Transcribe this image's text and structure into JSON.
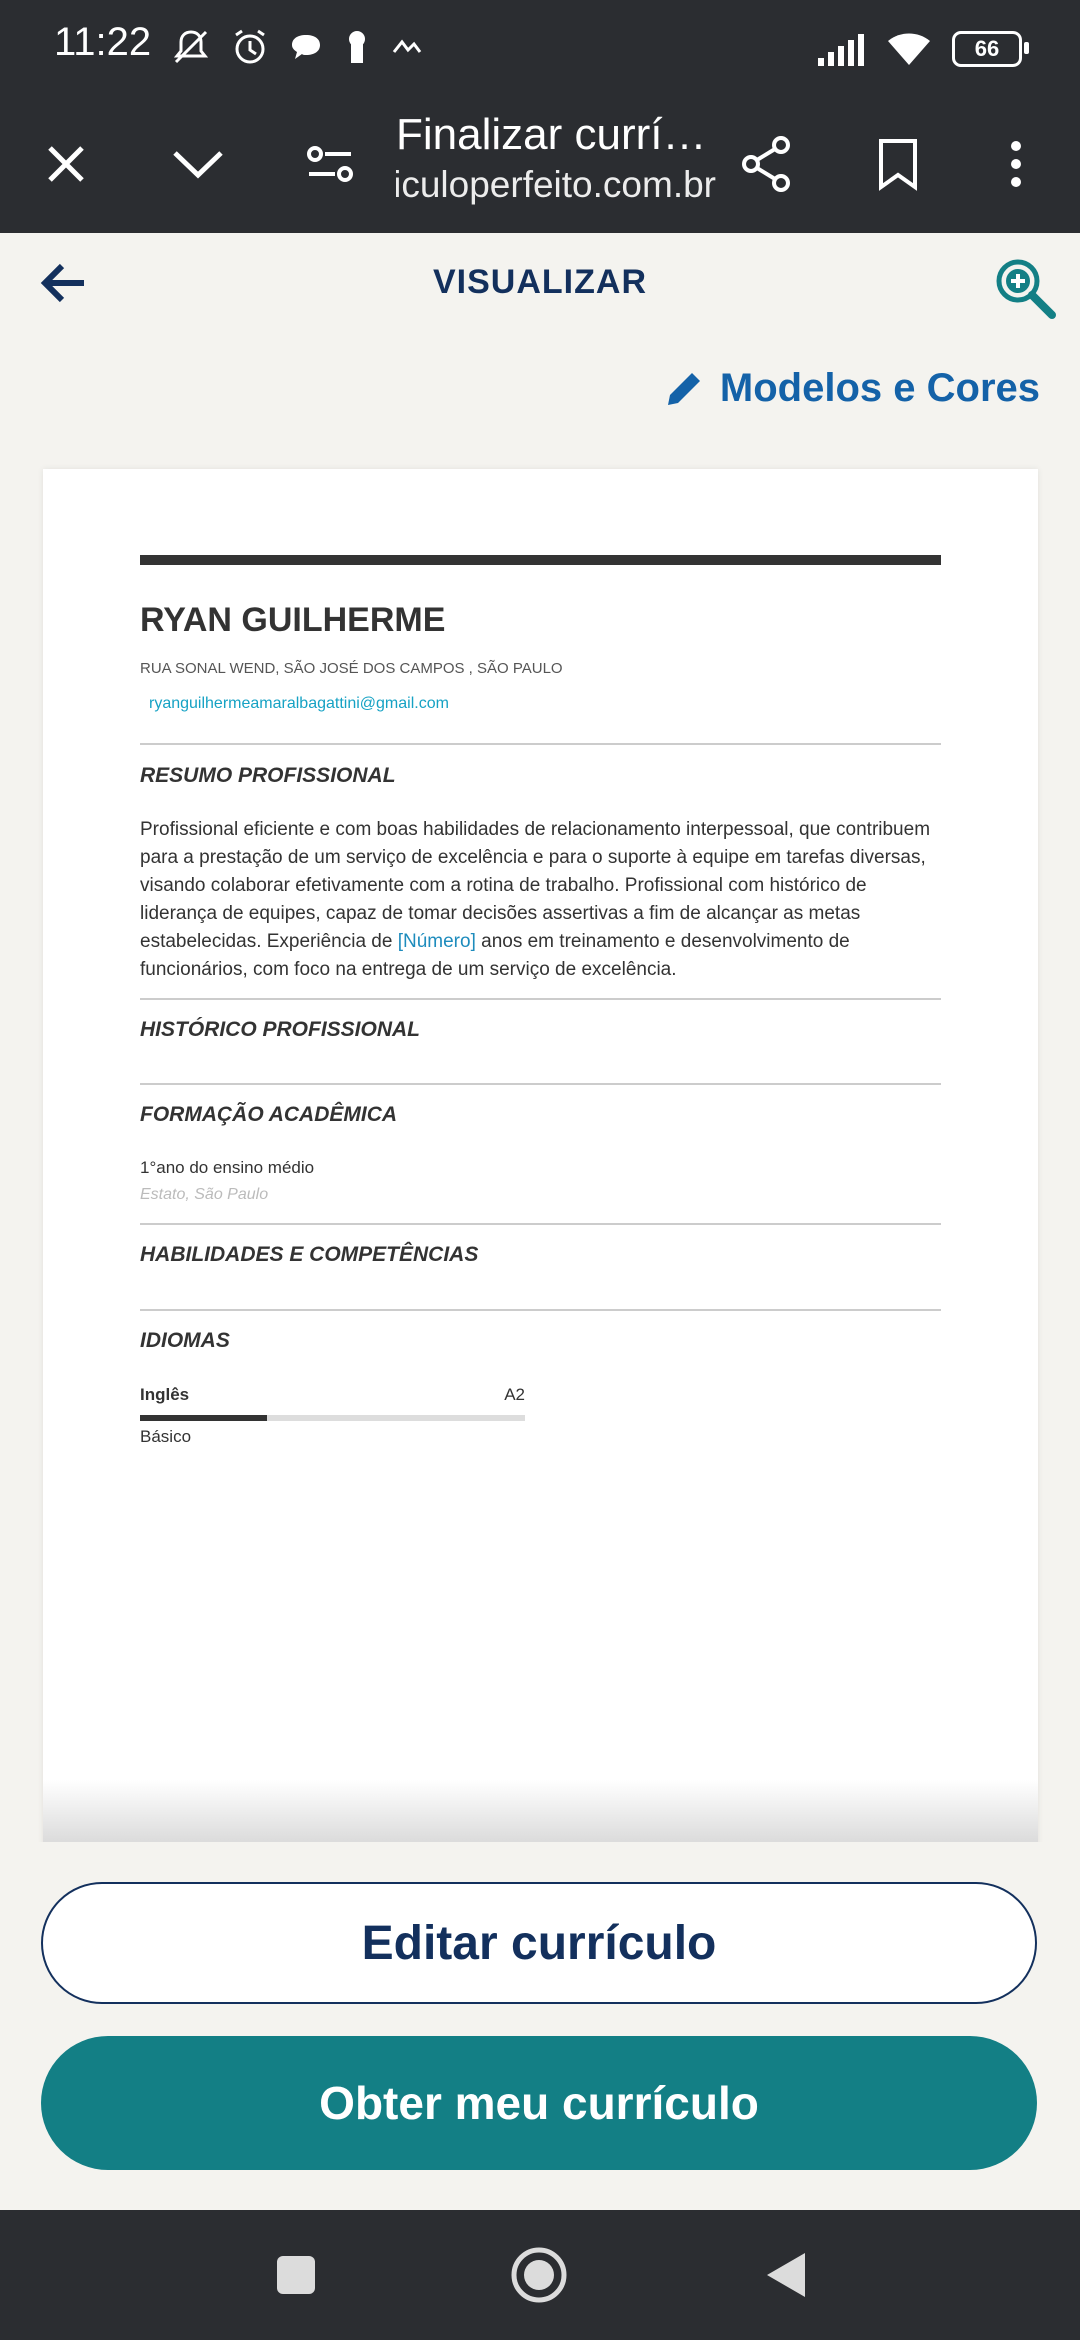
{
  "status_bar": {
    "time": "11:22",
    "battery": "66",
    "left_icons": [
      "mute-icon",
      "alarm-icon",
      "chat-bubble-icon",
      "keyhole-icon",
      "activity-icon"
    ],
    "right_icons": [
      "signal-icon",
      "wifi-icon",
      "battery-icon"
    ]
  },
  "browser": {
    "title": "Finalizar currículo",
    "url": "curriculoperfeito.com.br"
  },
  "header": {
    "title": "VISUALIZAR"
  },
  "actions": {
    "models_label": "Modelos e Cores",
    "edit_label": "Editar currículo",
    "get_label": "Obter meu currículo"
  },
  "resume": {
    "name": "RYAN GUILHERME",
    "address": "RUA SONAL WEND, SÃO JOSÉ DOS CAMPOS , SÃO PAULO",
    "email": "ryanguilhermeamaralbagattini@gmail.com",
    "summary_title": "RESUMO PROFISSIONAL",
    "summary_before": "Profissional eficiente e com boas habilidades de relacionamento interpessoal, que contribuem para a prestação de um serviço de excelência e para o suporte à equipe em tarefas diversas, visando colaborar efetivamente com a rotina de trabalho. Profissional com histórico de liderança de equipes, capaz de tomar decisões assertivas a fim de alcançar as metas estabelecidas. Experiência de ",
    "summary_placeholder": "[Número]",
    "summary_after": " anos em treinamento e desenvolvimento de funcionários, com foco na entrega de um serviço de excelência.",
    "history_title": "HISTÓRICO PROFISSIONAL",
    "education_title": "FORMAÇÃO ACADÊMICA",
    "education": {
      "course": "1°ano do ensino médio",
      "place": "Estato, São Paulo"
    },
    "skills_title": "HABILIDADES E COMPETÊNCIAS",
    "languages_title": "IDIOMAS",
    "language": {
      "name": "Inglês",
      "level": "A2",
      "description": "Básico",
      "proficiency_percent": 33
    }
  },
  "colors": {
    "navy": "#13305d",
    "link_blue": "#1462a8",
    "teal": "#137f85",
    "system_bar": "#2b2d31"
  }
}
